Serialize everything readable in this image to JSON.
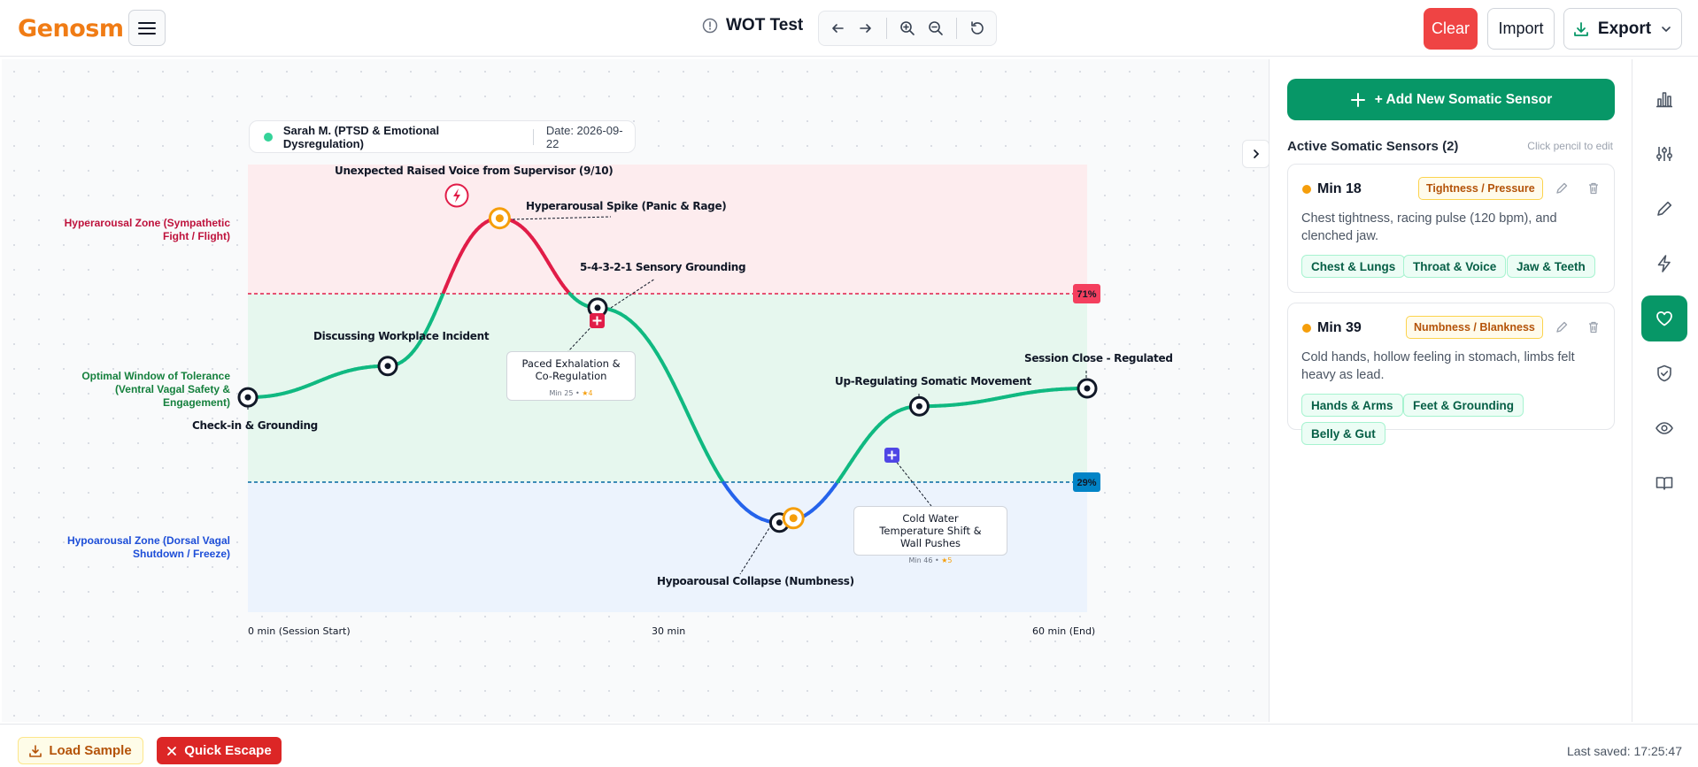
{
  "app": {
    "logo": "Genosm",
    "document_title": "WOT Test"
  },
  "toolbar": {
    "icons": [
      "undo-icon",
      "redo-icon",
      "zoom-in-icon",
      "zoom-out-icon",
      "reset-icon"
    ],
    "clear_label": "Clear",
    "import_label": "Import",
    "export_label": "Export"
  },
  "chart": {
    "patient": "Sarah M. (PTSD & Emotional Dysregulation)",
    "date": "Date: 2026-09-22",
    "zones": {
      "hyper": "Hyperarousal Zone (Sympathetic Fight / Flight)",
      "optimal": "Optimal Window of Tolerance (Ventral Vagal Safety & Engagement)",
      "hypo": "Hypoarousal Zone (Dorsal Vagal Shutdown / Freeze)"
    },
    "thresholds": {
      "upper": "71%",
      "lower": "29%"
    },
    "points": {
      "p1": "Check-in & Grounding",
      "p2": "Discussing Workplace Incident",
      "p3": "Hyperarousal Spike (Panic & Rage)",
      "p4": "5-4-3-2-1 Sensory Grounding",
      "p5": "Hypoarousal Collapse (Numbness)",
      "p6": "Up-Regulating Somatic Movement",
      "p7": "Session Close - Regulated"
    },
    "trigger": "Unexpected Raised Voice from Supervisor (9/10)",
    "notes": [
      {
        "text": "Paced Exhalation & Co-Regulation",
        "meta": "Min 25 • ",
        "stars": "★4"
      },
      {
        "text": "Cold Water Temperature Shift & Wall Pushes",
        "meta": "Min 46 • ",
        "stars": "★5"
      }
    ],
    "axis": {
      "start": "0 min (Session Start)",
      "mid": "30 min",
      "end": "60 min (End)"
    },
    "colors": {
      "hyper_line": "#e11d48",
      "optimal_line": "#10b981",
      "hypo_line": "#2563eb",
      "sensor": "#f59e0b"
    }
  },
  "chart_data": {
    "type": "line",
    "xlabel": "",
    "ylabel": "",
    "x_unit": "min",
    "xlim": [
      0,
      60
    ],
    "ylim": [
      0,
      100
    ],
    "thresholds": [
      71,
      29
    ],
    "series": [
      {
        "x": [
          0,
          10,
          18,
          25,
          38,
          48,
          60
        ],
        "y": [
          48,
          55,
          88,
          68,
          20,
          46,
          50
        ]
      }
    ],
    "sensor_markers": [
      {
        "x": 18,
        "y": 88
      },
      {
        "x": 39,
        "y": 21
      }
    ]
  },
  "panel": {
    "add_label": "+ Add New Somatic Sensor",
    "section_title": "Active Somatic Sensors (2)",
    "section_hint": "Click pencil to edit",
    "sensors": [
      {
        "title": "Min 18",
        "badge": "Tightness / Pressure",
        "desc": "Chest tightness, racing pulse (120 bpm), and clenched jaw.",
        "tags": [
          "Chest & Lungs",
          "Throat & Voice",
          "Jaw & Teeth"
        ]
      },
      {
        "title": "Min 39",
        "badge": "Numbness / Blankness",
        "desc": "Cold hands, hollow feeling in stomach, limbs felt heavy as lead.",
        "tags": [
          "Hands & Arms",
          "Feet & Grounding",
          "Belly & Gut"
        ]
      }
    ]
  },
  "rail": {
    "icons": [
      "chart-icon",
      "sliders-icon",
      "pencil-icon",
      "bolt-icon",
      "heart-icon",
      "shield-icon",
      "eye-icon",
      "book-icon"
    ],
    "active": "heart-icon"
  },
  "footer": {
    "load_label": "Load Sample",
    "escape_label": "Quick Escape",
    "saved": "Last saved: 17:25:47"
  }
}
